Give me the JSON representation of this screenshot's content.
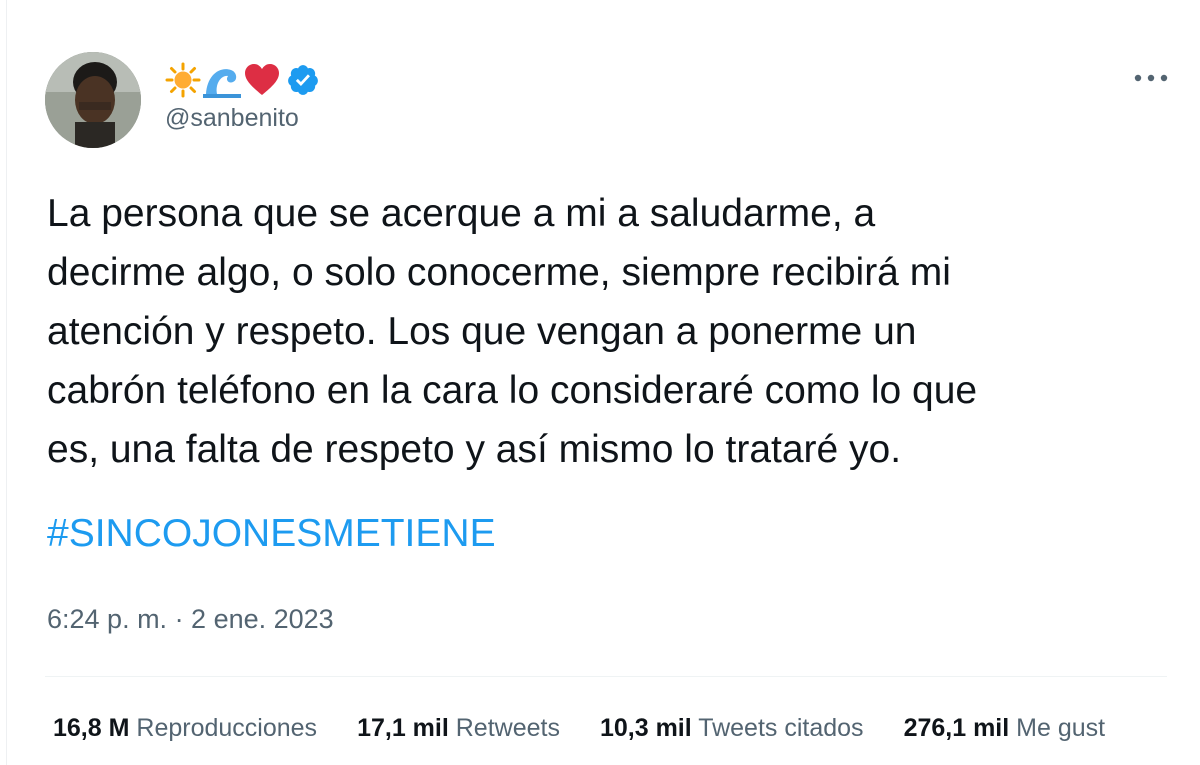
{
  "user": {
    "emoji_name": [
      "sun-icon",
      "wave-icon",
      "red-heart-icon"
    ],
    "verified": true,
    "handle": "@sanbenito"
  },
  "tweet": {
    "text": "La persona que se acerque a mi a saludarme, a\ndecirme algo, o solo conocerme, siempre recibirá mi\natención y respeto. Los que vengan a ponerme un\ncabrón teléfono en la cara lo consideraré como lo que\nes, una falta de respeto y así mismo lo trataré yo.",
    "hashtag": "#SINCOJONESMETIENE",
    "timestamp": "6:24 p. m. · 2 ene. 2023"
  },
  "stats": [
    {
      "value": "16,8 M",
      "label": "Reproducciones"
    },
    {
      "value": "17,1 mil",
      "label": "Retweets"
    },
    {
      "value": "10,3 mil",
      "label": "Tweets citados"
    },
    {
      "value": "276,1 mil",
      "label": "Me gust"
    }
  ],
  "colors": {
    "link": "#1d9bf0",
    "secondary_text": "#536471",
    "verified_badge": "#1d9bf0"
  }
}
